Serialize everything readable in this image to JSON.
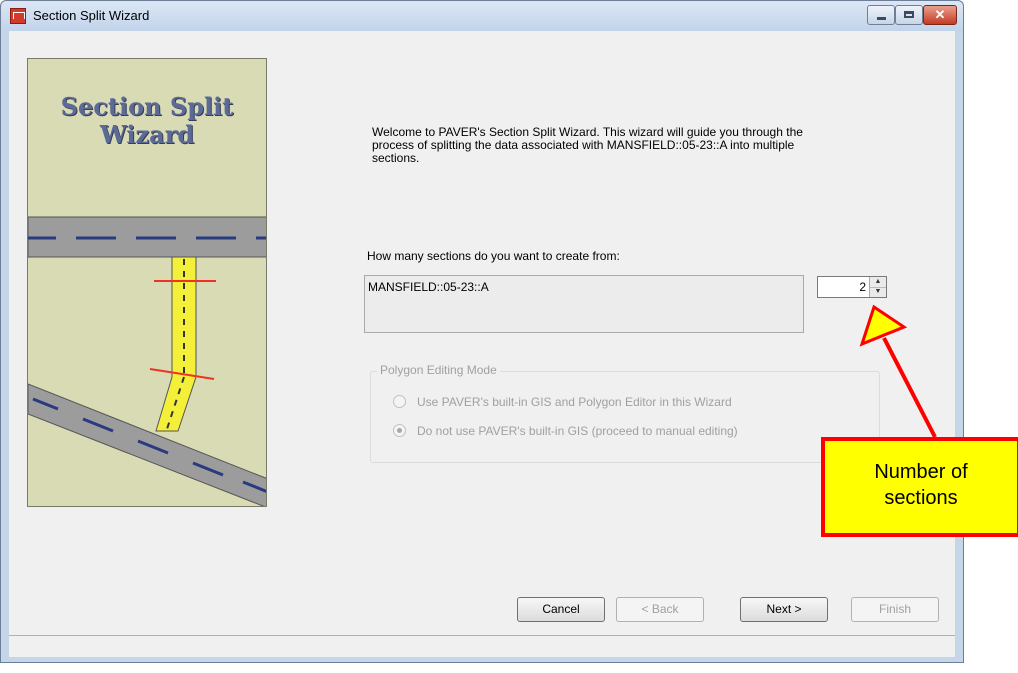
{
  "window": {
    "title": "Section Split Wizard"
  },
  "illustration": {
    "title_line1": "Section Split",
    "title_line2": "Wizard"
  },
  "intro": {
    "text": "Welcome to PAVER's Section Split Wizard.  This wizard will guide you through the process of splitting the data associated with MANSFIELD::05-23::A into multiple sections."
  },
  "sections": {
    "question": "How many sections do you want to create from:",
    "source": "MANSFIELD::05-23::A",
    "count": "2"
  },
  "polygon_mode": {
    "legend": "Polygon Editing Mode",
    "options": [
      {
        "label": "Use PAVER's built-in GIS and Polygon Editor in this Wizard",
        "checked": false
      },
      {
        "label": "Do not use PAVER's built-in GIS (proceed to manual editing)",
        "checked": true
      }
    ],
    "enabled": false
  },
  "buttons": {
    "cancel": "Cancel",
    "back": "< Back",
    "next": "Next >",
    "finish": "Finish"
  },
  "callout": {
    "line1": "Number of",
    "line2": "sections"
  },
  "colors": {
    "callout_fill": "#ffff00",
    "callout_border": "#ff0000",
    "illustration_bg": "#d8dbb4",
    "road": "#9a9a9a",
    "lane_marks": "#2a3a80"
  }
}
